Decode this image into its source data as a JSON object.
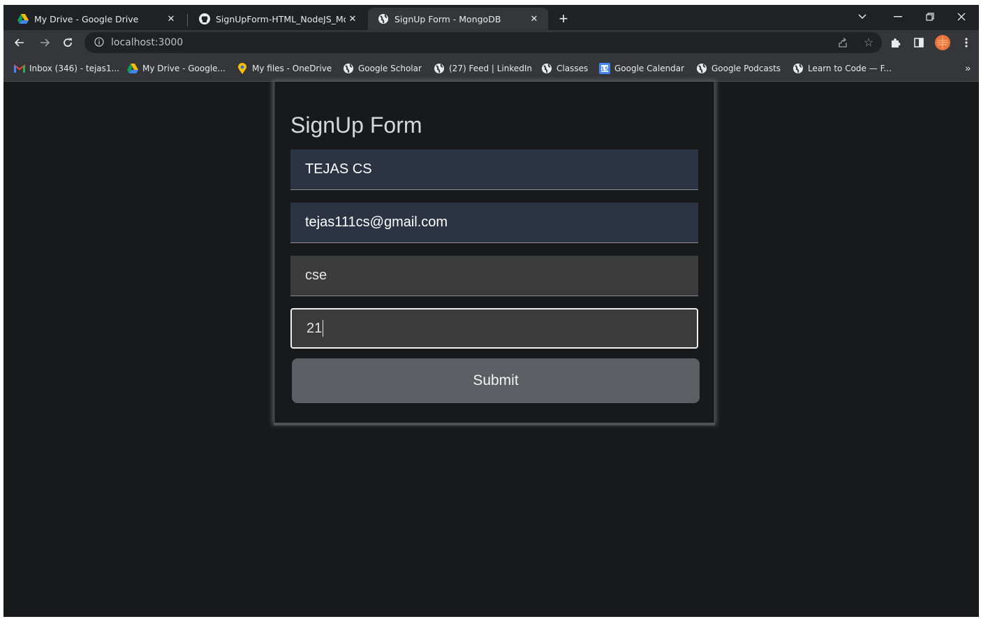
{
  "tabs": [
    {
      "title": "My Drive - Google Drive",
      "icon": "google-drive-icon",
      "active": false
    },
    {
      "title": "SignUpForm-HTML_NodeJS_Mon",
      "icon": "github-icon",
      "active": false
    },
    {
      "title": "SignUp Form - MongoDB",
      "icon": "globe-icon",
      "active": true
    }
  ],
  "toolbar": {
    "url": "localhost:3000"
  },
  "bookmarks": [
    {
      "label": "Inbox (346) - tejas1...",
      "icon": "gmail-icon"
    },
    {
      "label": "My Drive - Google...",
      "icon": "google-drive-icon"
    },
    {
      "label": "My files - OneDrive",
      "icon": "map-pin-icon"
    },
    {
      "label": "Google Scholar",
      "icon": "globe-icon"
    },
    {
      "label": "(27) Feed | LinkedIn",
      "icon": "globe-icon"
    },
    {
      "label": "Classes",
      "icon": "globe-icon"
    },
    {
      "label": "Google Calendar",
      "icon": "calendar-icon"
    },
    {
      "label": "Google Podcasts",
      "icon": "globe-icon"
    },
    {
      "label": "Learn to Code — F...",
      "icon": "globe-icon"
    }
  ],
  "bookmarks_more": "»",
  "form": {
    "title": "SignUp Form",
    "name_value": "TEJAS CS",
    "email_value": "tejas111cs@gmail.com",
    "branch_value": "cse",
    "age_value": "21",
    "submit_label": "Submit"
  },
  "colors": {
    "page_bg": "#18191b",
    "autofill_bg": "#2c3342",
    "field_bg": "#3b3b3b",
    "button_bg": "#5b5f63"
  }
}
